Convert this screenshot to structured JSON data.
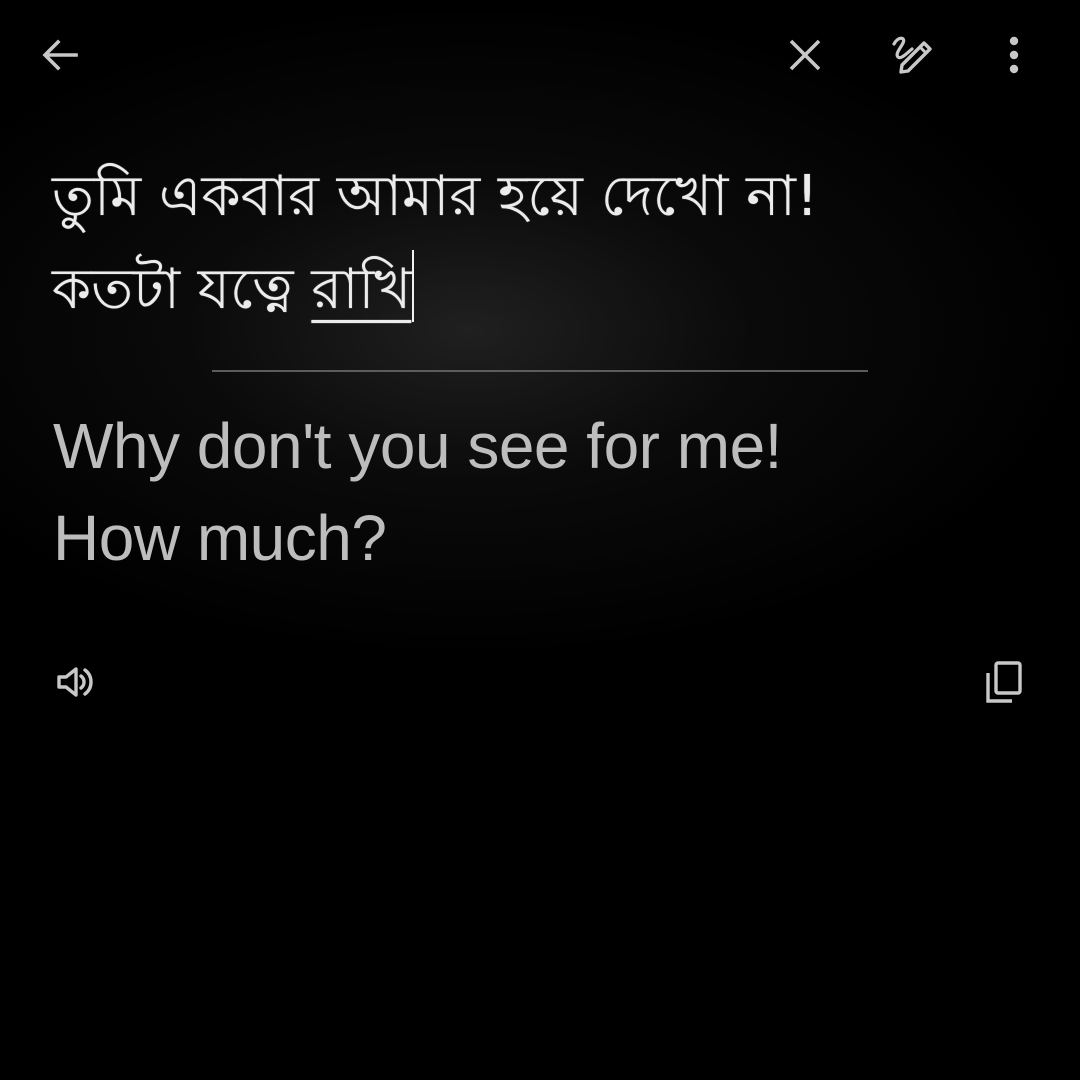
{
  "toolbar": {
    "icons": [
      "arrow-back-icon",
      "close-icon",
      "handwriting-pen-icon",
      "more-vert-icon"
    ]
  },
  "source": {
    "line1": "তুমি একবার আমার হয়ে দেখো না!",
    "line2_plain": "কতটা যত্নে ",
    "line2_underlined": "রাখি"
  },
  "translation": {
    "line1": "Why don't you see for me!",
    "line2": "How much?"
  },
  "actions": {
    "icons": [
      "volume-up-icon",
      "copy-icon"
    ]
  },
  "colors": {
    "background": "#000000",
    "source_text": "#ececec",
    "translation_text": "#bdbdbd",
    "icon": "#c8c8c8",
    "divider": "#5c5c5c"
  }
}
